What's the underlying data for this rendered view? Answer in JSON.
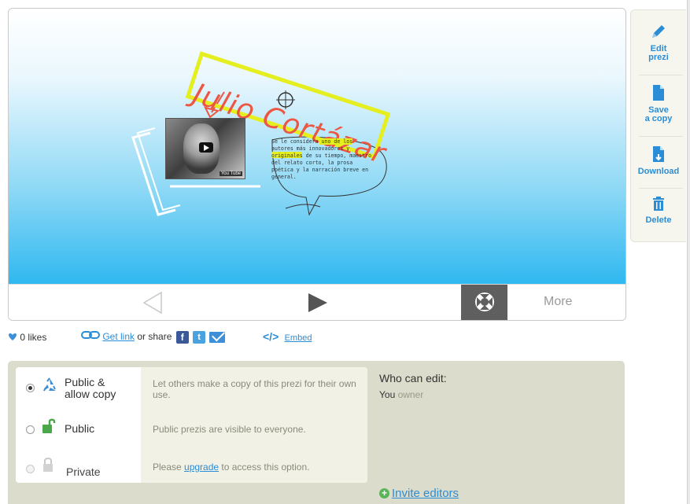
{
  "presentation": {
    "title_text": "Julio Cortázar",
    "bio_text": "Se le considera uno de los autores más innovadores y originales de su tiempo, maestro del relato corto, la prosa poética y la narración breve en general.",
    "video_badge": "You Tube"
  },
  "controls": {
    "more_label": "More"
  },
  "sidebar": {
    "items": [
      {
        "label": "Edit prezi",
        "icon": "pencil-icon"
      },
      {
        "label": "Save a copy",
        "icon": "document-icon"
      },
      {
        "label": "Download",
        "icon": "download-icon"
      },
      {
        "label": "Delete",
        "icon": "trash-icon"
      }
    ]
  },
  "actions": {
    "likes": "0 likes",
    "get_link": "Get link",
    "or_share": " or share",
    "embed": "Embed"
  },
  "privacy": {
    "options": [
      {
        "name": "Public & allow copy",
        "desc": "Let others make a copy of this prezi for their own use.",
        "selected": true
      },
      {
        "name": "Public",
        "desc": "Public prezis are visible to everyone.",
        "selected": false
      },
      {
        "name": "Private",
        "desc_before": "Please ",
        "desc_link": "upgrade",
        "desc_after": " to access this option.",
        "selected": false,
        "disabled": true
      }
    ],
    "who_can_edit": "Who can edit:",
    "owner_name": "You",
    "owner_role": "owner",
    "invite_label": "Invite editors"
  },
  "colors": {
    "accent": "#2b8dd6",
    "title_red": "#ec5744",
    "highlight_yellow": "#e5ef1f",
    "panel_bg": "#dcdccc"
  }
}
